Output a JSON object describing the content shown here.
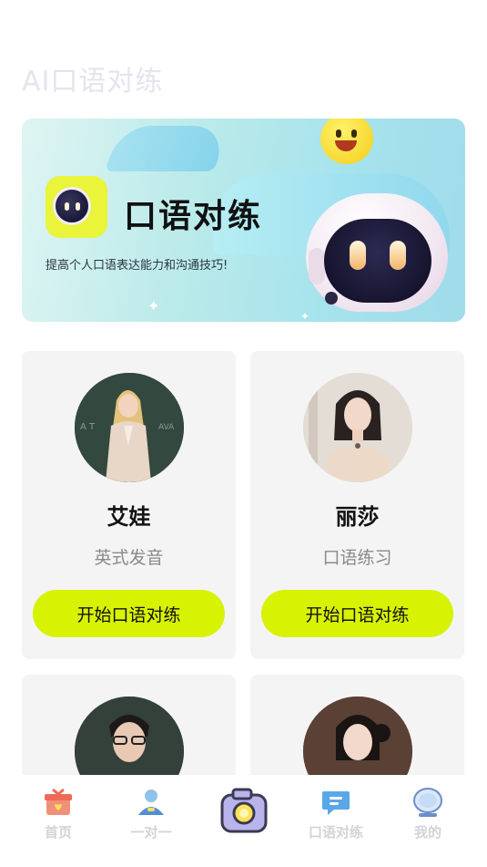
{
  "header": {
    "title": "AI口语对练"
  },
  "banner": {
    "title": "口语对练",
    "subtitle": "提高个人口语表达能力和沟通技巧!"
  },
  "tutors": [
    {
      "name": "艾娃",
      "tag": "英式发音",
      "button": "开始口语对练"
    },
    {
      "name": "丽莎",
      "tag": "口语练习",
      "button": "开始口语对练"
    },
    {
      "name": "",
      "tag": "",
      "button": ""
    },
    {
      "name": "",
      "tag": "",
      "button": ""
    }
  ],
  "bottom_nav": {
    "items": [
      {
        "label": "首页",
        "icon": "gift-home-icon"
      },
      {
        "label": "一对一",
        "icon": "person-icon"
      },
      {
        "label": "",
        "icon": "camera-icon"
      },
      {
        "label": "口语对练",
        "icon": "chat-bubble-icon"
      },
      {
        "label": "我的",
        "icon": "profile-bubble-icon"
      }
    ]
  },
  "colors": {
    "accent": "#d7f203",
    "card_bg": "#f4f4f4",
    "nav_label": "#d3d3d8"
  }
}
